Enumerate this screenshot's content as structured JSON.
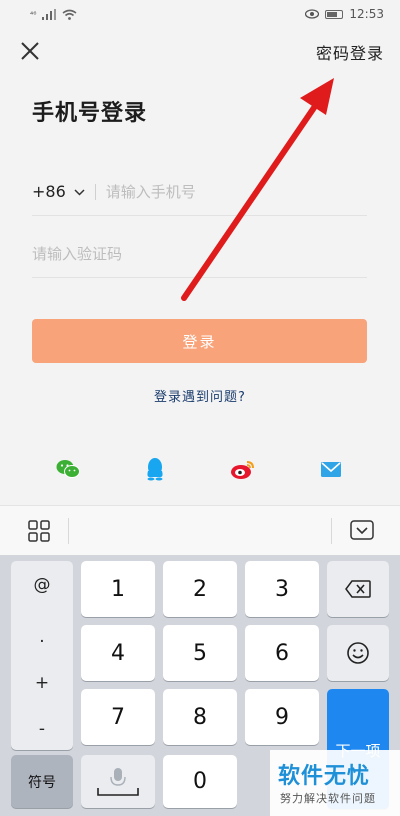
{
  "status_bar": {
    "signal_text": "⁴⁶",
    "time": "12:53"
  },
  "header": {
    "close_icon": "close-icon",
    "password_login_label": "密码登录"
  },
  "page_title": "手机号登录",
  "phone": {
    "country_code": "+86",
    "placeholder": "请输入手机号"
  },
  "verification": {
    "placeholder": "请输入验证码"
  },
  "login_button": "登录",
  "trouble_link": "登录遇到问题?",
  "social": {
    "icons": [
      "wechat-icon",
      "qq-icon",
      "weibo-icon",
      "mail-icon"
    ],
    "colors": {
      "wechat": "#3cb034",
      "qq": "#19a6f0",
      "weibo": "#e6162d",
      "mail": "#2fa4e7"
    }
  },
  "keyboard": {
    "symbols": [
      "@",
      ".",
      "+",
      "-"
    ],
    "digits": [
      "1",
      "2",
      "3",
      "4",
      "5",
      "6",
      "7",
      "8",
      "9",
      "0"
    ],
    "symbol_key": "符号",
    "next_key": "下一项",
    "accent": "#1e88f0"
  },
  "watermark": {
    "title": "软件无忧",
    "subtitle": "努力解决软件问题"
  },
  "annotation_color": "#e01b1b"
}
